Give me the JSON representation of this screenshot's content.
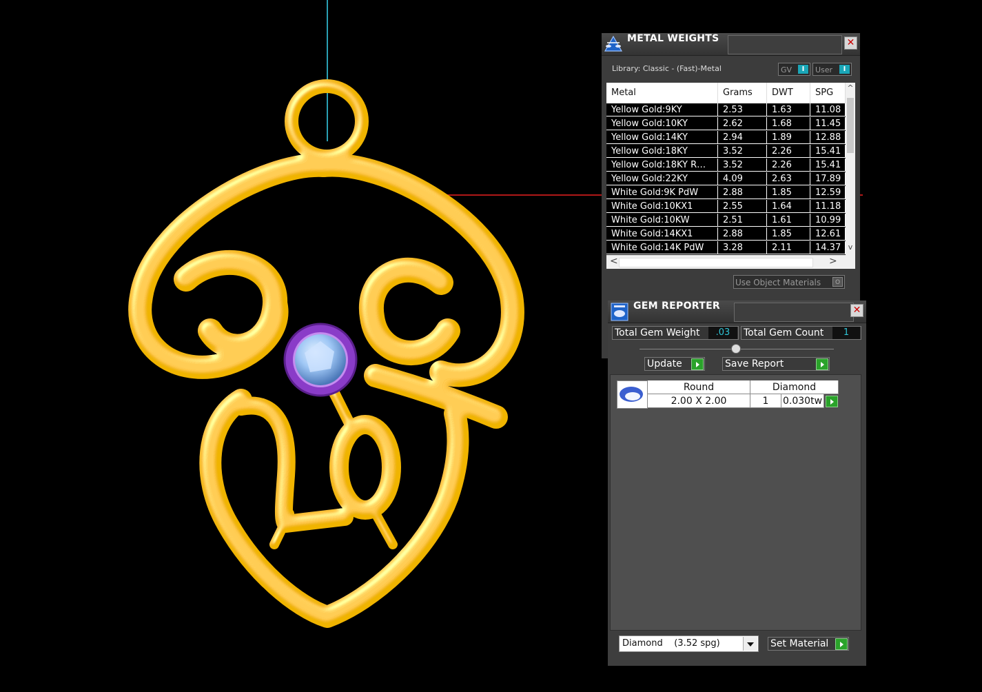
{
  "metal_weights": {
    "title": "METAL WEIGHTS",
    "library": "Library: Classic - (Fast)-Metal",
    "gv_label": "GV",
    "user_label": "User",
    "toggle_glyph": "I",
    "columns": [
      "Metal",
      "Grams",
      "DWT",
      "SPG"
    ],
    "rows": [
      {
        "metal": "Yellow Gold:9KY",
        "grams": "2.53",
        "dwt": "1.63",
        "spg": "11.08"
      },
      {
        "metal": "Yellow Gold:10KY",
        "grams": "2.62",
        "dwt": "1.68",
        "spg": "11.45"
      },
      {
        "metal": "Yellow Gold:14KY",
        "grams": "2.94",
        "dwt": "1.89",
        "spg": "12.88"
      },
      {
        "metal": "Yellow Gold:18KY",
        "grams": "3.52",
        "dwt": "2.26",
        "spg": "15.41"
      },
      {
        "metal": "Yellow Gold:18KY R…",
        "grams": "3.52",
        "dwt": "2.26",
        "spg": "15.41"
      },
      {
        "metal": "Yellow Gold:22KY",
        "grams": "4.09",
        "dwt": "2.63",
        "spg": "17.89"
      },
      {
        "metal": "White Gold:9K PdW",
        "grams": "2.88",
        "dwt": "1.85",
        "spg": "12.59"
      },
      {
        "metal": "White Gold:10KX1",
        "grams": "2.55",
        "dwt": "1.64",
        "spg": "11.18"
      },
      {
        "metal": "White Gold:10KW",
        "grams": "2.51",
        "dwt": "1.61",
        "spg": "10.99"
      },
      {
        "metal": "White Gold:14KX1",
        "grams": "2.88",
        "dwt": "1.85",
        "spg": "12.61"
      },
      {
        "metal": "White Gold:14K PdW",
        "grams": "3.28",
        "dwt": "2.11",
        "spg": "14.37"
      }
    ],
    "use_object_materials": "Use Object Materials",
    "close_glyph": "✕"
  },
  "gem_reporter": {
    "title": "GEM REPORTER",
    "total_gem_weight_label": "Total Gem Weight",
    "total_gem_weight": ".03",
    "total_gem_count_label": "Total Gem Count",
    "total_gem_count": "1",
    "update_label": "Update",
    "save_report_label": "Save Report",
    "gem": {
      "shape": "Round",
      "material": "Diamond",
      "size": "2.00 X 2.00",
      "count": "1",
      "weight": "0.030tw"
    },
    "material_select": "Diamond    (3.52 spg)",
    "set_material_label": "Set Material",
    "close_glyph": "✕"
  },
  "colors": {
    "gold": "#f0b400",
    "amethyst_bezel": "#8a3cc8",
    "stone": "#9fc7f5",
    "toggle_accent": "#1aa6b7",
    "go_button": "#2aa32a"
  }
}
